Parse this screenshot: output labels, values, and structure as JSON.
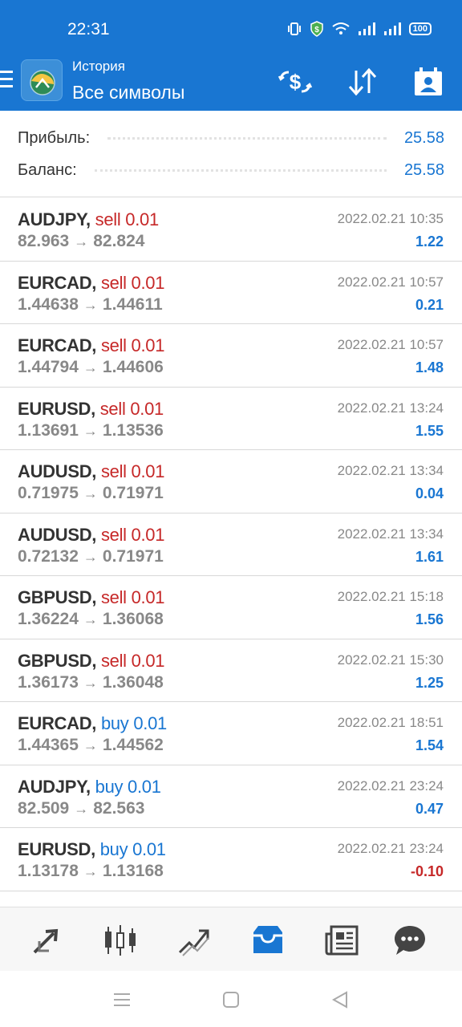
{
  "status": {
    "time": "22:31",
    "battery": "100",
    "icons": [
      "vibrate-icon",
      "shield-icon",
      "wifi-icon",
      "signal-icon",
      "signal-icon",
      "battery-icon"
    ]
  },
  "appbar": {
    "subtitle": "История",
    "title": "Все символы",
    "actions": [
      "currency-exchange-icon",
      "sort-icon",
      "calendar-icon"
    ]
  },
  "summary": {
    "profit_label": "Прибыль:",
    "profit_value": "25.58",
    "balance_label": "Баланс:",
    "balance_value": "25.58"
  },
  "deals": [
    {
      "symbol": "AUDJPY,",
      "action": "sell 0.01",
      "type": "sell",
      "open": "82.963",
      "close": "82.824",
      "time": "2022.02.21 10:35",
      "profit": "1.22"
    },
    {
      "symbol": "EURCAD,",
      "action": "sell 0.01",
      "type": "sell",
      "open": "1.44638",
      "close": "1.44611",
      "time": "2022.02.21 10:57",
      "profit": "0.21"
    },
    {
      "symbol": "EURCAD,",
      "action": "sell 0.01",
      "type": "sell",
      "open": "1.44794",
      "close": "1.44606",
      "time": "2022.02.21 10:57",
      "profit": "1.48"
    },
    {
      "symbol": "EURUSD,",
      "action": "sell 0.01",
      "type": "sell",
      "open": "1.13691",
      "close": "1.13536",
      "time": "2022.02.21 13:24",
      "profit": "1.55"
    },
    {
      "symbol": "AUDUSD,",
      "action": "sell 0.01",
      "type": "sell",
      "open": "0.71975",
      "close": "0.71971",
      "time": "2022.02.21 13:34",
      "profit": "0.04"
    },
    {
      "symbol": "AUDUSD,",
      "action": "sell 0.01",
      "type": "sell",
      "open": "0.72132",
      "close": "0.71971",
      "time": "2022.02.21 13:34",
      "profit": "1.61"
    },
    {
      "symbol": "GBPUSD,",
      "action": "sell 0.01",
      "type": "sell",
      "open": "1.36224",
      "close": "1.36068",
      "time": "2022.02.21 15:18",
      "profit": "1.56"
    },
    {
      "symbol": "GBPUSD,",
      "action": "sell 0.01",
      "type": "sell",
      "open": "1.36173",
      "close": "1.36048",
      "time": "2022.02.21 15:30",
      "profit": "1.25"
    },
    {
      "symbol": "EURCAD,",
      "action": "buy 0.01",
      "type": "buy",
      "open": "1.44365",
      "close": "1.44562",
      "time": "2022.02.21 18:51",
      "profit": "1.54"
    },
    {
      "symbol": "AUDJPY,",
      "action": "buy 0.01",
      "type": "buy",
      "open": "82.509",
      "close": "82.563",
      "time": "2022.02.21 23:24",
      "profit": "0.47"
    },
    {
      "symbol": "EURUSD,",
      "action": "buy 0.01",
      "type": "buy",
      "open": "1.13178",
      "close": "1.13168",
      "time": "2022.02.21 23:24",
      "profit": "-0.10"
    }
  ],
  "bottom_nav": [
    "quotes-icon",
    "chart-icon",
    "trade-icon",
    "history-icon",
    "news-icon",
    "chat-icon"
  ],
  "colors": {
    "accent": "#1976d2",
    "sell": "#c62828",
    "buy": "#1976d2",
    "negative": "#c62828"
  }
}
